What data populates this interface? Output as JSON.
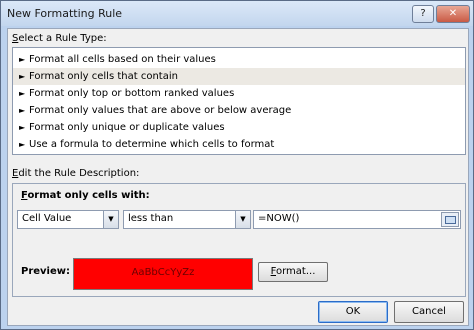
{
  "window": {
    "title": "New Formatting Rule",
    "help_label": "?",
    "close_label": "✕"
  },
  "rule_type": {
    "label_key": "S",
    "label_rest": "elect a Rule Type:",
    "items": [
      {
        "label": "Format all cells based on their values"
      },
      {
        "label": "Format only cells that contain"
      },
      {
        "label": "Format only top or bottom ranked values"
      },
      {
        "label": "Format only values that are above or below average"
      },
      {
        "label": "Format only unique or duplicate values"
      },
      {
        "label": "Use a formula to determine which cells to format"
      }
    ],
    "selected_index": 1
  },
  "description": {
    "label_key": "E",
    "label_rest": "dit the Rule Description:",
    "subheading_key": "F",
    "subheading_rest": "ormat only cells with:",
    "condition_type": "Cell Value",
    "operator": "less than",
    "formula": "=NOW()",
    "preview_label": "Preview:",
    "preview_sample": "AaBbCcYyZz",
    "preview_fill": "#ff0000",
    "format_button_key": "F",
    "format_button_rest": "ormat..."
  },
  "buttons": {
    "ok": "OK",
    "cancel": "Cancel"
  },
  "icons": {
    "list_arrow": "triangle-right",
    "dropdown": "chevron-down",
    "range_ref": "collapse-dialog-icon"
  }
}
